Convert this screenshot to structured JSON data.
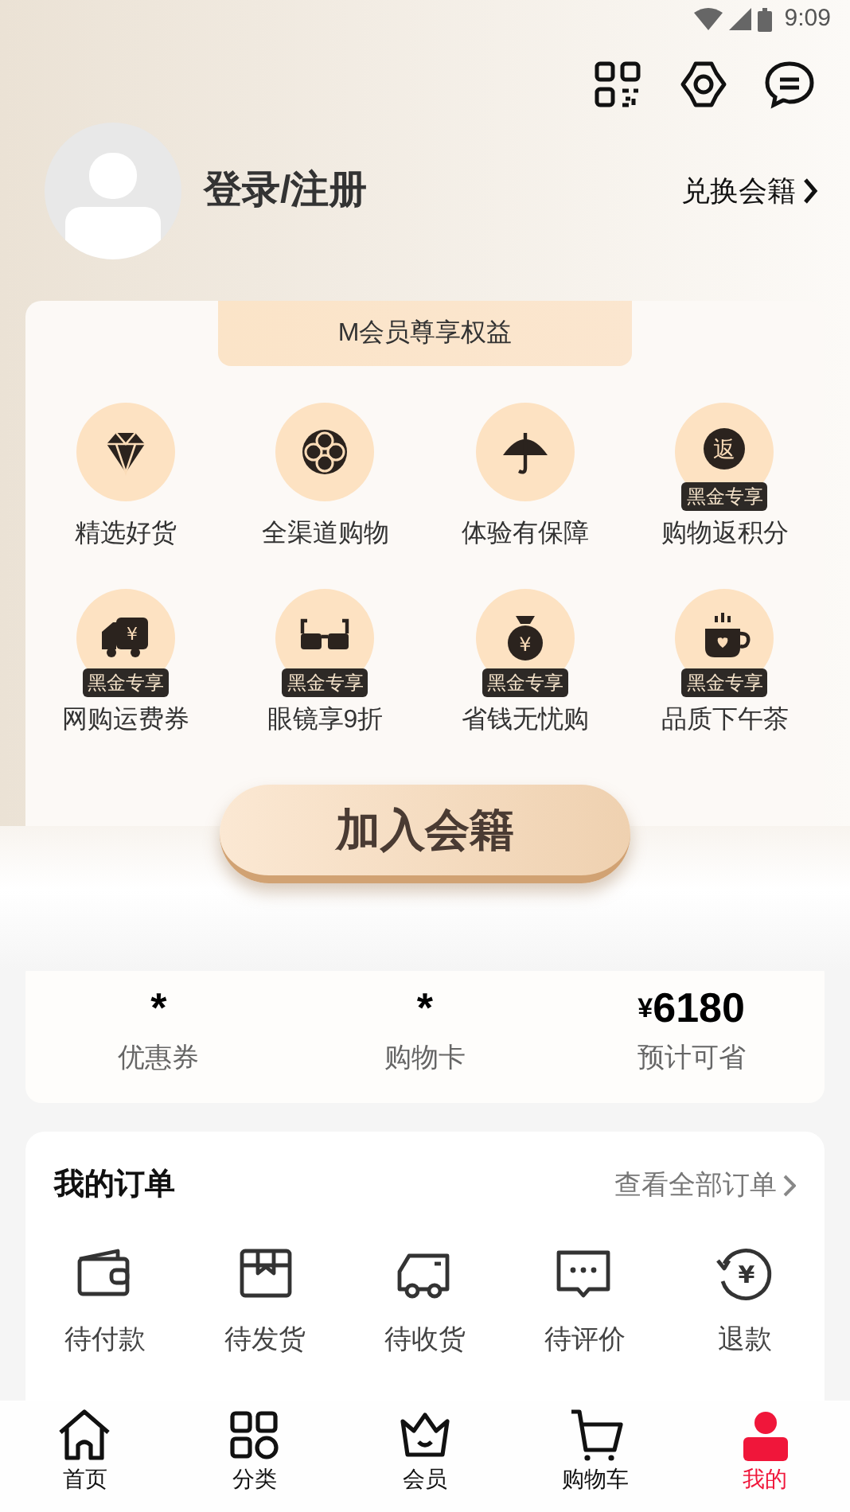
{
  "status_bar": {
    "time": "9:09"
  },
  "profile": {
    "login": "登录/注册",
    "exchange": "兑换会籍"
  },
  "benefits": {
    "title": "M会员尊享权益",
    "items": [
      {
        "label": "精选好货"
      },
      {
        "label": "全渠道购物"
      },
      {
        "label": "体验有保障"
      },
      {
        "label": "购物返积分",
        "badge": "黑金专享",
        "icon_text": "返"
      },
      {
        "label": "网购运费券",
        "badge": "黑金专享",
        "icon_text": "¥"
      },
      {
        "label": "眼镜享9折",
        "badge": "黑金专享"
      },
      {
        "label": "省钱无忧购",
        "badge": "黑金专享",
        "icon_text": "¥"
      },
      {
        "label": "品质下午茶",
        "badge": "黑金专享"
      }
    ]
  },
  "join_button": "加入会籍",
  "stats": [
    {
      "value": "*",
      "label": "优惠券"
    },
    {
      "value": "*",
      "label": "购物卡"
    },
    {
      "currency": "¥",
      "value": "6180",
      "label": "预计可省"
    }
  ],
  "orders": {
    "title": "我的订单",
    "view_all": "查看全部订单",
    "items": [
      {
        "label": "待付款"
      },
      {
        "label": "待发货"
      },
      {
        "label": "待收货"
      },
      {
        "label": "待评价"
      },
      {
        "label": "退款",
        "icon_text": "¥"
      }
    ]
  },
  "nav": [
    {
      "label": "首页",
      "selected": false
    },
    {
      "label": "分类",
      "selected": false
    },
    {
      "label": "会员",
      "selected": false
    },
    {
      "label": "购物车",
      "selected": false
    },
    {
      "label": "我的",
      "selected": true
    }
  ]
}
